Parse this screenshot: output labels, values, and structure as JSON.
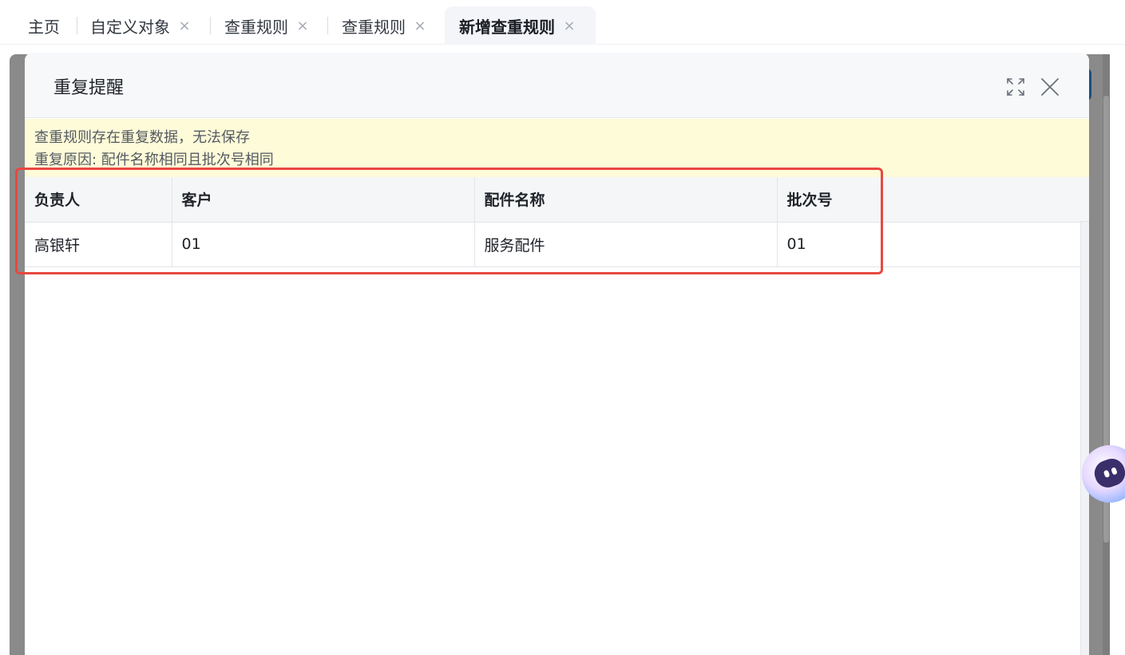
{
  "tabs": [
    {
      "label": "主页",
      "closable": false,
      "active": false
    },
    {
      "label": "自定义对象",
      "closable": true,
      "active": false
    },
    {
      "label": "查重规则",
      "closable": true,
      "active": false
    },
    {
      "label": "查重规则",
      "closable": true,
      "active": false
    },
    {
      "label": "新增查重规则",
      "closable": true,
      "active": true
    }
  ],
  "tab_close_glyph": "×",
  "dialog": {
    "title": "重复提醒",
    "expand_icon": "expand-icon",
    "close_icon": "close-icon"
  },
  "warning": {
    "line1": "查重规则存在重复数据，无法保存",
    "line2": "重复原因: 配件名称相同且批次号相同"
  },
  "table": {
    "columns": [
      "负责人",
      "客户",
      "配件名称",
      "批次号"
    ],
    "rows": [
      [
        "高银轩",
        "01",
        "服务配件",
        "01"
      ]
    ]
  },
  "colors": {
    "highlight": "#e8483f",
    "warning_bg": "#fdfbd8",
    "active_tab_bg": "#f3f5f9"
  }
}
